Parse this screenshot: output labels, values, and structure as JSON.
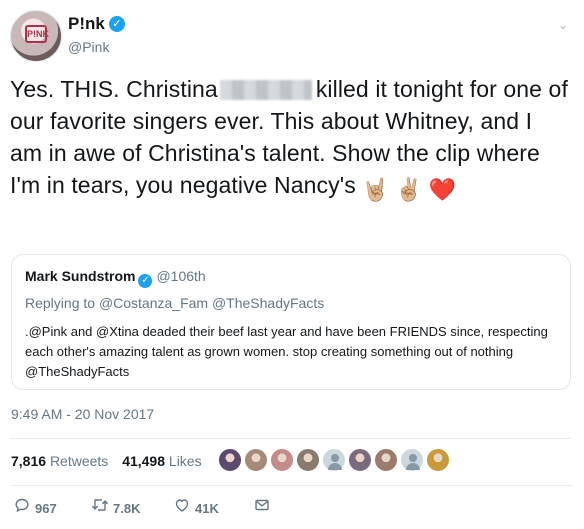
{
  "author": {
    "display_name": "P!nk",
    "handle": "@Pink",
    "avatar_text": "P!NK"
  },
  "tweet": {
    "text_part1": "Yes. THIS. Christina",
    "text_part2": "killed it tonight for one of our favorite singers ever. This about Whitney, and I am in awe of Christina's talent.  Show the clip where I'm in tears, you negative Nancy's",
    "emojis": [
      "🤘🏼",
      "✌🏼",
      "❤️"
    ]
  },
  "quoted": {
    "display_name": "Mark Sundstrom",
    "handle": "@106th",
    "replying_label": "Replying to",
    "replying_to": "@Costanza_Fam @TheShadyFacts",
    "text": ".@Pink and @Xtina deaded their beef last year and have been FRIENDS since, respecting each other's amazing talent as grown women. stop creating something out of nothing @TheShadyFacts"
  },
  "timestamp": "9:49 AM - 20 Nov 2017",
  "stats": {
    "retweets_count": "7,816",
    "retweets_label": "Retweets",
    "likes_count": "41,498",
    "likes_label": "Likes"
  },
  "liker_avatar_colors": [
    "#5b4a6e",
    "#a58a7a",
    "#c48b8b",
    "#8a7a6e",
    "default",
    "#7a6a7e",
    "#9b7b6b",
    "default",
    "#c99a3a"
  ],
  "actions": {
    "reply_count": "967",
    "retweet_count": "7.8K",
    "like_count": "41K"
  },
  "colors": {
    "verified": "#1da1f2",
    "heart": "#d0021b",
    "muted": "#657786"
  },
  "icons": {
    "reply": "reply-icon",
    "retweet": "retweet-icon",
    "like": "heart-icon",
    "dm": "mail-icon",
    "more": "chevron-down-icon"
  }
}
